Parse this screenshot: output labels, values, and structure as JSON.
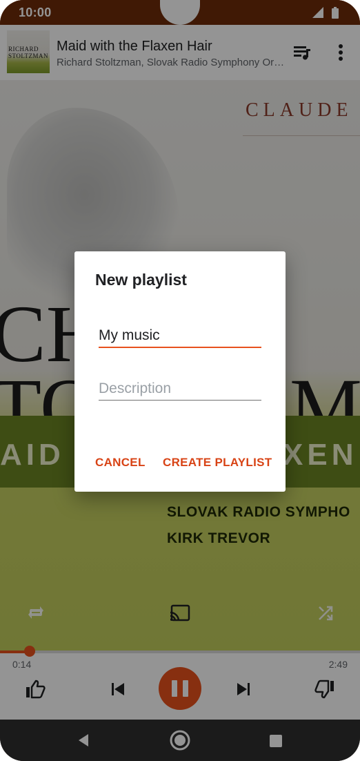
{
  "status_bar": {
    "time": "10:00"
  },
  "now_playing": {
    "thumbnail_text": "RICHARD STOLTZMAN",
    "title": "Maid with the Flaxen Hair",
    "artist": "Richard Stoltzman, Slovak Radio Symphony Orc…"
  },
  "artwork": {
    "composer": "CLAUDE",
    "big_line1": "CH",
    "big_line2": "TO",
    "big_right": "M",
    "band_left": "AID",
    "band_right": "XEN",
    "credit1": "SLOVAK RADIO SYMPHO",
    "credit2": "KIRK TREVOR"
  },
  "player": {
    "elapsed": "0:14",
    "duration": "2:49",
    "progress": 0.083,
    "accent": "#e8511d"
  },
  "dialog": {
    "title": "New playlist",
    "name_value": "My music",
    "description_placeholder": "Description",
    "cancel_label": "CANCEL",
    "create_label": "CREATE PLAYLIST"
  }
}
